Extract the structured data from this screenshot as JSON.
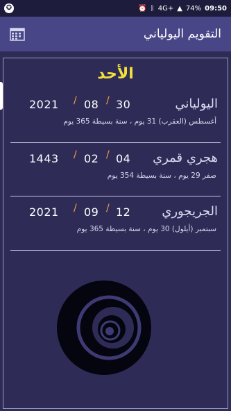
{
  "status_bar": {
    "network": "4G+",
    "battery": "74%",
    "time": "09:50"
  },
  "app_bar": {
    "title": "التقويم اليولياني",
    "menu_icon": "calendar-grid-icon"
  },
  "day_name": "الأحد",
  "calendars": [
    {
      "name": "اليولياني",
      "day": "30",
      "month": "08",
      "year": "2021",
      "info": "أغسطس (العقرب) 31 يوم ، سنة بسيطة 365 يوم"
    },
    {
      "name": "هجري قمري",
      "day": "04",
      "month": "02",
      "year": "1443",
      "info": "صفر 29 يوم ، سنة بسيطة 354 يوم"
    },
    {
      "name": "الجريجوري",
      "day": "12",
      "month": "09",
      "year": "2021",
      "info": "سبتمبر (أيلول) 30 يوم ، سنة بسيطة 365 يوم"
    }
  ],
  "colors": {
    "background": "#2e2c57",
    "app_bar": "#494688",
    "day_highlight": "#f2e03c",
    "separator_slash": "#f2a23c"
  }
}
